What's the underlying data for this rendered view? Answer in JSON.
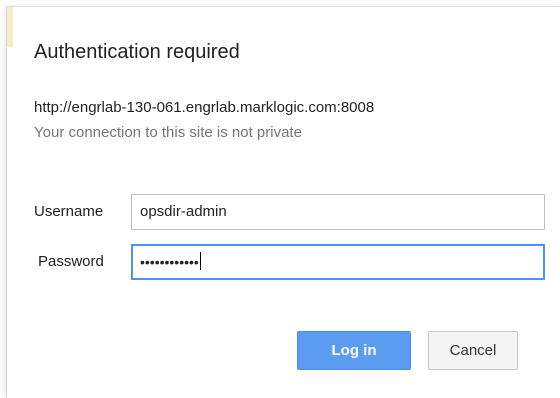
{
  "dialog": {
    "title": "Authentication required",
    "url": "http://engrlab-130-061.engrlab.marklogic.com:8008",
    "privacy_note": "Your connection to this site is not private"
  },
  "form": {
    "username_label": "Username",
    "username_value": "opsdir-admin",
    "password_label": "Password",
    "password_masked": "••••••••••••"
  },
  "buttons": {
    "login_label": "Log in",
    "cancel_label": "Cancel"
  },
  "colors": {
    "primary_button": "#5b9cf1",
    "focus_border": "#4d90fe",
    "muted_text": "#767676"
  }
}
